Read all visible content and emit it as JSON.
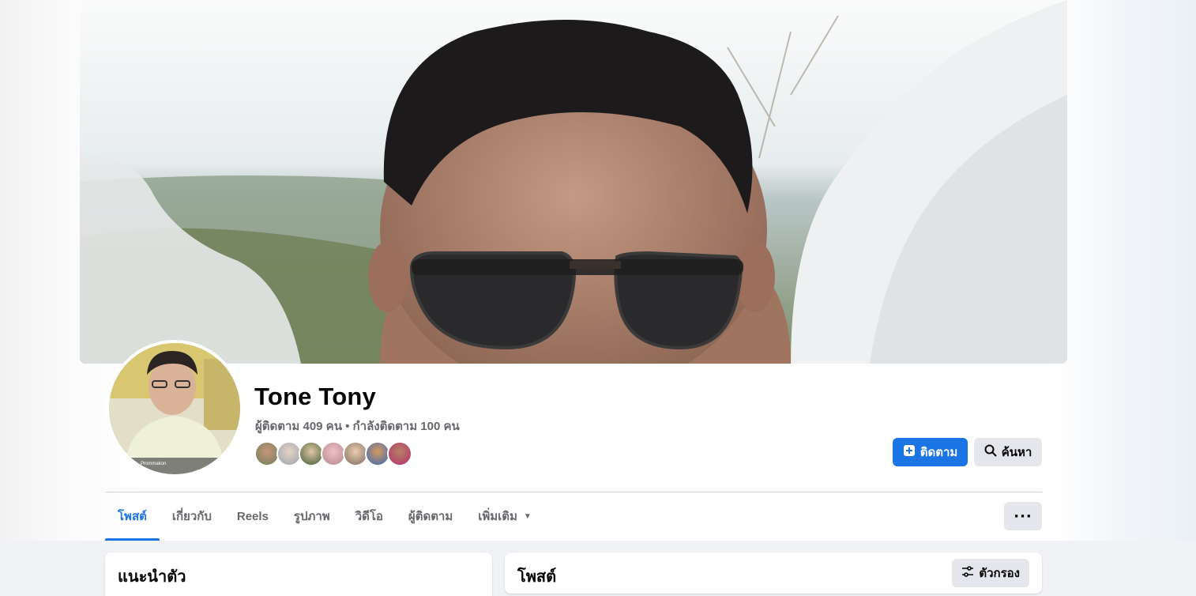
{
  "profile": {
    "name": "Tone Tony",
    "follow_stats": "ผู้ติดตาม 409 คน • กำลังติดตาม 100 คน",
    "avatar_caption": "Prommakon"
  },
  "actions": {
    "follow_label": "ติดตาม",
    "search_label": "ค้นหา",
    "more_label": "···"
  },
  "tabs": [
    {
      "label": "โพสต์",
      "active": true
    },
    {
      "label": "เกี่ยวกับ"
    },
    {
      "label": "Reels"
    },
    {
      "label": "รูปภาพ"
    },
    {
      "label": "วิดีโอ"
    },
    {
      "label": "ผู้ติดตาม"
    },
    {
      "label": "เพิ่มเติม"
    }
  ],
  "intro": {
    "title": "แนะนำตัว"
  },
  "posts": {
    "title": "โพสต์",
    "filter_label": "ตัวกรอง"
  },
  "colors": {
    "accent": "#1b74e4",
    "button_gray": "#e4e6eb",
    "secondary_text": "#65676b",
    "page_background": "#f0f2f5"
  },
  "icons": {
    "follow": "user-add-icon",
    "search": "search-icon",
    "tab_more": "caret-down-icon",
    "more": "more-dots-icon",
    "filter": "filter-icon"
  }
}
